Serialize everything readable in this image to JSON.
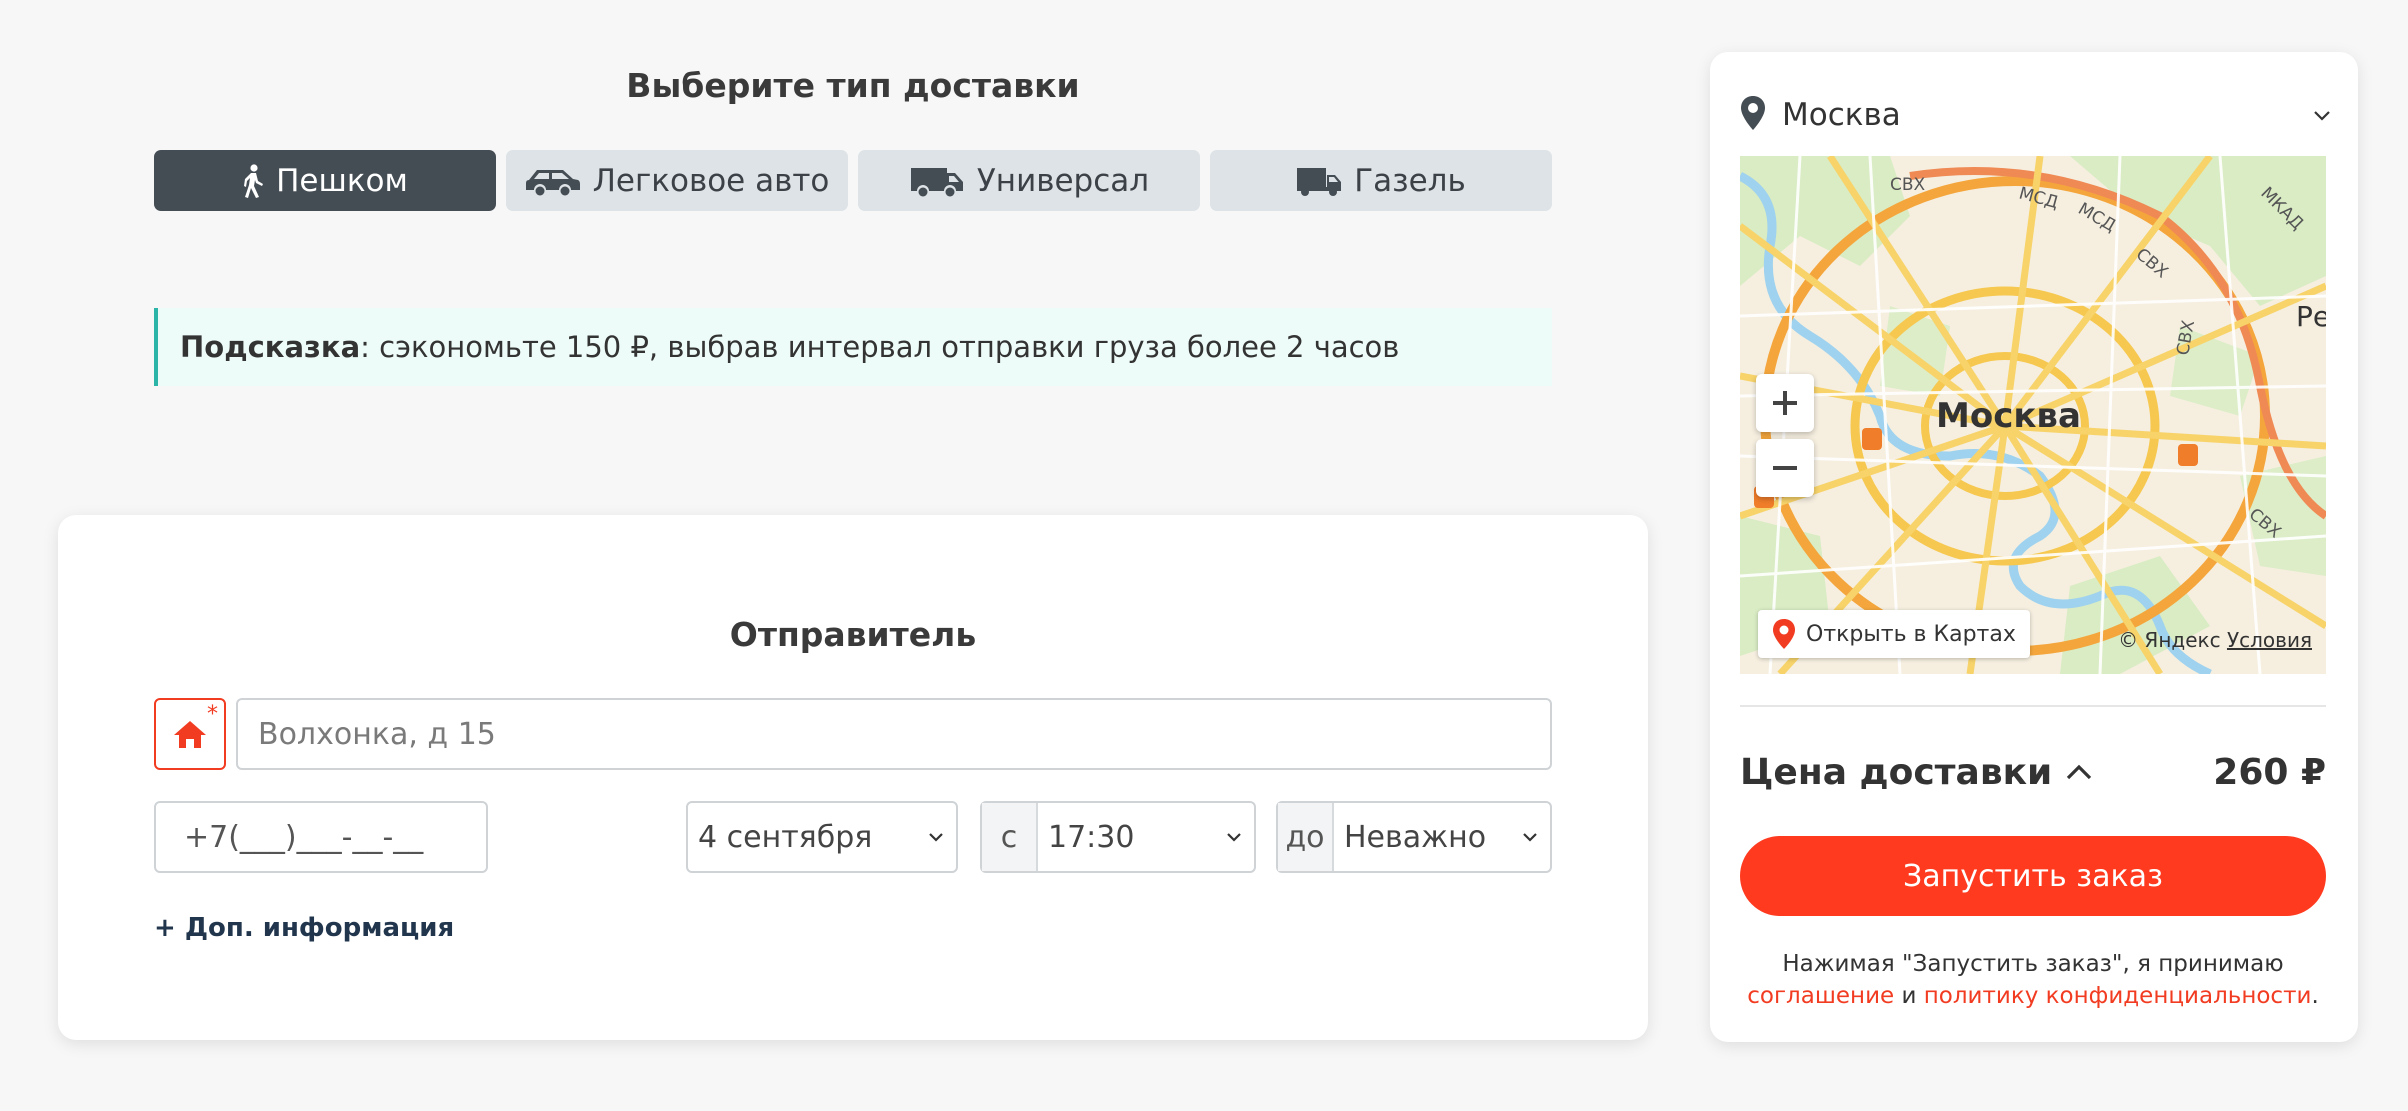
{
  "delivery": {
    "title": "Выберите тип доставки",
    "types": [
      {
        "label": "Пешком",
        "icon": "walking-icon",
        "active": true
      },
      {
        "label": "Легковое авто",
        "icon": "car-icon",
        "active": false
      },
      {
        "label": "Универсал",
        "icon": "van-icon",
        "active": false
      },
      {
        "label": "Газель",
        "icon": "truck-icon",
        "active": false
      }
    ]
  },
  "hint": {
    "title": "Подсказка",
    "text": ": сэкономьте 150 ₽, выбрав интервал отправки груза более 2 часов"
  },
  "sender": {
    "title": "Отправитель",
    "address_required_mark": "*",
    "address_placeholder": "Волхонка, д 15",
    "phone_placeholder": "+7(___)___-__-__",
    "date_value": "4 сентября",
    "from_prefix": "с",
    "from_value": "17:30",
    "to_prefix": "до",
    "to_value": "Неважно",
    "more_info": "+ Доп. информация"
  },
  "panel": {
    "city": "Москва",
    "map": {
      "city_label": "Москва",
      "open_in_maps": "Открыть в Картах",
      "copyright": "© Яндекс",
      "terms": "Условия",
      "road_labels": [
        "СВХ",
        "МСД",
        "МСД",
        "СВХ",
        "МКАД",
        "СВХ",
        "СВХ",
        "Ре"
      ]
    },
    "price_label": "Цена доставки",
    "price_value": "260 ₽",
    "launch_button": "Запустить заказ",
    "consent": {
      "prefix": "Нажимая \"Запустить заказ\", я принимаю",
      "agreement_link": "соглашение",
      "and": "и",
      "privacy_link": "политику конфиденциальности",
      "suffix": "."
    }
  },
  "colors": {
    "accent": "#ff3a1f",
    "active_tab": "#454d54",
    "inactive_tab": "#dde3e6",
    "hint_border": "#2bb5a8",
    "hint_bg": "#eefcf9",
    "link_dark": "#21364d"
  }
}
